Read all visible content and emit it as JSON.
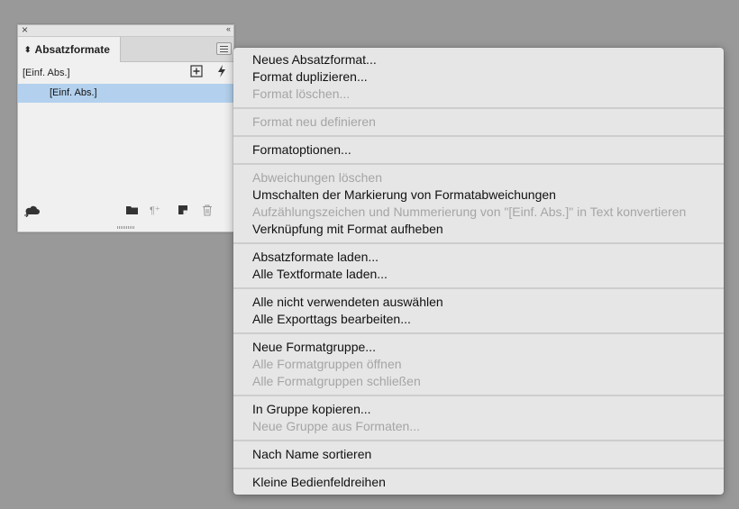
{
  "panel": {
    "tab_label": "Absatzformate",
    "current_style": "[Einf. Abs.]",
    "list_items": [
      "[Einf. Abs.]"
    ],
    "icons": [
      "close-icon",
      "collapse-icon",
      "panel-menu-icon",
      "new-style-icon",
      "quick-apply-icon",
      "cloud-library-icon",
      "folder-icon",
      "clear-overrides-icon",
      "new-item-icon",
      "trash-icon"
    ]
  },
  "menu": {
    "items": [
      {
        "label": "Neues Absatzformat...",
        "enabled": true
      },
      {
        "label": "Format duplizieren...",
        "enabled": true
      },
      {
        "label": "Format löschen...",
        "enabled": false
      },
      {
        "label": "Format neu definieren",
        "enabled": false
      },
      {
        "label": "Formatoptionen...",
        "enabled": true
      },
      {
        "label": "Abweichungen löschen",
        "enabled": false
      },
      {
        "label": "Umschalten der Markierung von Formatabweichungen",
        "enabled": true
      },
      {
        "label": "Aufzählungszeichen und Nummerierung von \"[Einf. Abs.]\" in Text konvertieren",
        "enabled": false
      },
      {
        "label": "Verknüpfung mit Format aufheben",
        "enabled": true
      },
      {
        "label": "Absatzformate laden...",
        "enabled": true
      },
      {
        "label": "Alle Textformate laden...",
        "enabled": true
      },
      {
        "label": "Alle nicht verwendeten auswählen",
        "enabled": true
      },
      {
        "label": "Alle Exporttags bearbeiten...",
        "enabled": true
      },
      {
        "label": "Neue Formatgruppe...",
        "enabled": true
      },
      {
        "label": "Alle Formatgruppen öffnen",
        "enabled": false
      },
      {
        "label": "Alle Formatgruppen schließen",
        "enabled": false
      },
      {
        "label": "In Gruppe kopieren...",
        "enabled": true
      },
      {
        "label": "Neue Gruppe aus Formaten...",
        "enabled": false
      },
      {
        "label": "Nach Name sortieren",
        "enabled": true
      },
      {
        "label": "Kleine Bedienfeldreihen",
        "enabled": true
      }
    ]
  }
}
